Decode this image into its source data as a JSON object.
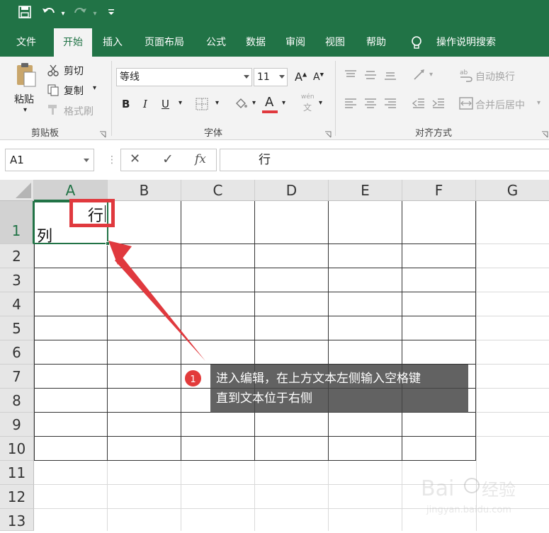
{
  "quick_access": {
    "save_icon": "save-icon",
    "undo_icon": "undo-icon",
    "redo_icon": "redo-icon",
    "customize_icon": "customize-icon"
  },
  "menu": {
    "tabs": [
      "文件",
      "开始",
      "插入",
      "页面布局",
      "公式",
      "数据",
      "审阅",
      "视图",
      "帮助"
    ],
    "active_tab": "开始",
    "tell_me": "操作说明搜索"
  },
  "ribbon": {
    "clipboard": {
      "paste": "粘贴",
      "cut": "剪切",
      "copy": "复制",
      "format_painter": "格式刷",
      "label": "剪贴板"
    },
    "font": {
      "name": "等线",
      "size": "11",
      "label": "字体",
      "bold": "B",
      "italic": "I",
      "underline": "U",
      "color_letter": "A",
      "phonetic_top": "wén",
      "phonetic_bottom": "文"
    },
    "alignment": {
      "wrap": "自动换行",
      "merge": "合并后居中",
      "label": "对齐方式"
    }
  },
  "formula_bar": {
    "name_box": "A1",
    "cancel": "✕",
    "enter": "✓",
    "fx": "fx",
    "content": "行"
  },
  "sheet": {
    "columns": [
      "A",
      "B",
      "C",
      "D",
      "E",
      "F",
      "G"
    ],
    "rows": [
      "1",
      "2",
      "3",
      "4",
      "5",
      "6",
      "7",
      "8",
      "9",
      "10",
      "11",
      "12",
      "13"
    ],
    "selected_cell": "A1",
    "a1_top": "行",
    "a1_bottom": "列"
  },
  "callout": {
    "step": "1",
    "text_line1": "进入编辑，在上方文本左侧输入空格键",
    "text_line2": "直到文本位于右侧"
  },
  "colors": {
    "excel_green": "#217346",
    "annotation_red": "#e0393e"
  },
  "watermark": {
    "brand": "Baidu 经验",
    "url": "jingyan.baidu.com"
  }
}
